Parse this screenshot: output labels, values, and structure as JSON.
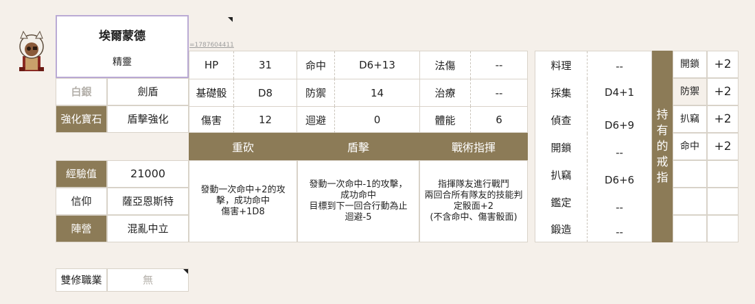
{
  "profile": {
    "name": "埃爾蒙德",
    "race": "精靈",
    "id_link": "=1787604411"
  },
  "identity": {
    "rank": "白銀",
    "class": "劍盾",
    "gem_label": "強化寶石",
    "gem_value": "盾擊強化",
    "exp_label": "經驗值",
    "exp_value": "21000",
    "faith_label": "信仰",
    "faith_value": "薩亞恩斯特",
    "camp_label": "陣營",
    "camp_value": "混亂中立",
    "dual_label": "雙修職業",
    "dual_value": "無"
  },
  "stats": {
    "rows": [
      [
        {
          "label": "HP",
          "value": "31"
        },
        {
          "label": "命中",
          "value": "D6+13"
        },
        {
          "label": "法傷",
          "value": "--"
        }
      ],
      [
        {
          "label": "基礎骰",
          "value": "D8"
        },
        {
          "label": "防禦",
          "value": "14"
        },
        {
          "label": "治療",
          "value": "--"
        }
      ],
      [
        {
          "label": "傷害",
          "value": "12"
        },
        {
          "label": "迴避",
          "value": "0"
        },
        {
          "label": "體能",
          "value": "6"
        }
      ]
    ]
  },
  "skills": [
    {
      "name": "重砍",
      "desc": "發動一次命中+2的攻擊，成功命中\n傷害+1D8"
    },
    {
      "name": "盾擊",
      "desc": "發動一次命中-1的攻擊，\n成功命中\n目標到下一回合行動為止\n迴避-5"
    },
    {
      "name": "戰術指揮",
      "desc": "指揮隊友進行戰鬥\n兩回合所有隊友的技能判定骰面+2\n(不含命中、傷害骰面)"
    }
  ],
  "abilities": {
    "labels": [
      "料理",
      "採集",
      "偵查",
      "開鎖",
      "扒竊",
      "鑑定",
      "鍛造"
    ],
    "values": [
      "--",
      "D4+1",
      "D6+9",
      "--",
      "D6+6",
      "--",
      "--"
    ]
  },
  "rings": {
    "title": "持有的戒指",
    "items": [
      {
        "label": "開鎖",
        "value": "+2"
      },
      {
        "label": "防禦",
        "value": "+2"
      },
      {
        "label": "扒竊",
        "value": "+2"
      },
      {
        "label": "命中",
        "value": "+2"
      },
      {
        "label": "",
        "value": ""
      },
      {
        "label": "",
        "value": ""
      },
      {
        "label": "",
        "value": ""
      }
    ]
  }
}
